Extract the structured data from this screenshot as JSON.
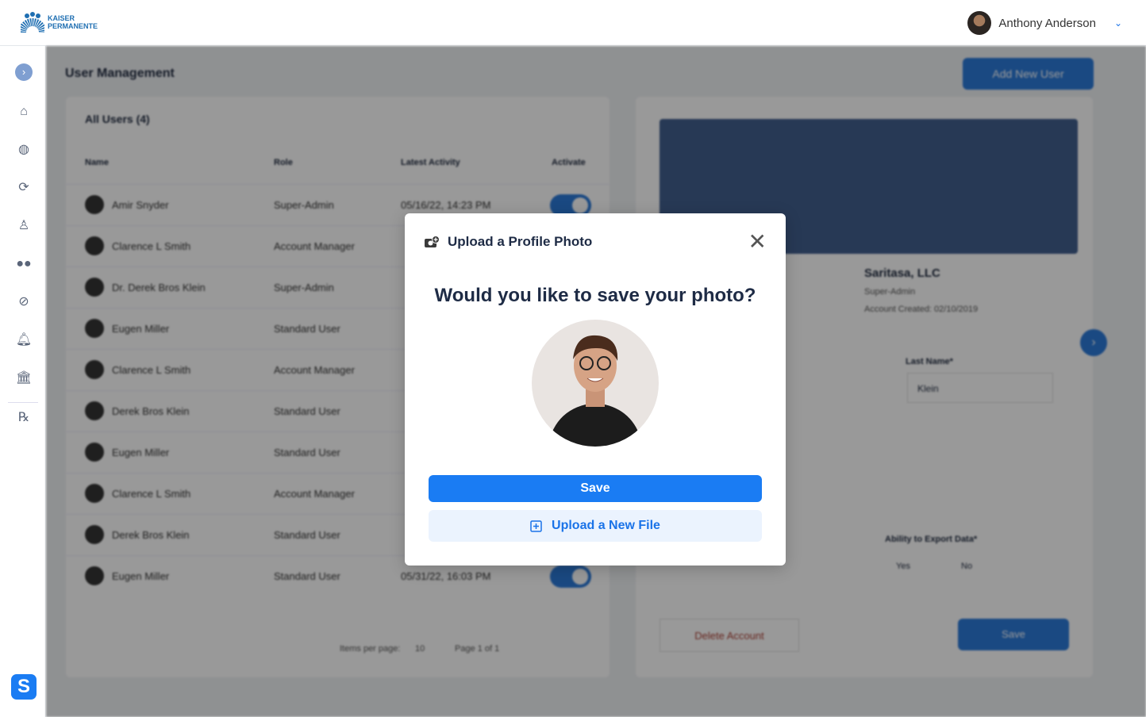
{
  "header": {
    "logo_line1": "KAISER",
    "logo_line2": "PERMANENTE",
    "user_name": "Anthony Anderson"
  },
  "sidebar": {
    "items": [
      "home-icon",
      "globe-icon",
      "sync-icon",
      "user-icon",
      "binoculars-icon",
      "pills-icon",
      "bell-icon",
      "bank-icon",
      "rx-icon"
    ]
  },
  "page": {
    "title": "User Management",
    "add_user": "Add New User"
  },
  "table": {
    "title": "All Users (4)",
    "columns": [
      "Name",
      "Role",
      "Latest Activity",
      "Activate"
    ],
    "rows": [
      {
        "name": "Amir Snyder",
        "role": "Super-Admin",
        "activity": "05/16/22, 14:23 PM"
      },
      {
        "name": "Clarence L Smith",
        "role": "Account Manager",
        "activity": ""
      },
      {
        "name": "Dr. Derek Bros Klein",
        "role": "Super-Admin",
        "activity": ""
      },
      {
        "name": "Eugen Miller",
        "role": "Standard User",
        "activity": ""
      },
      {
        "name": "Clarence L Smith",
        "role": "Account Manager",
        "activity": ""
      },
      {
        "name": "Derek Bros Klein",
        "role": "Standard User",
        "activity": ""
      },
      {
        "name": "Eugen Miller",
        "role": "Standard User",
        "activity": ""
      },
      {
        "name": "Clarence L Smith",
        "role": "Account Manager",
        "activity": ""
      },
      {
        "name": "Derek Bros Klein",
        "role": "Standard User",
        "activity": ""
      },
      {
        "name": "Eugen Miller",
        "role": "Standard User",
        "activity": "05/31/22, 16:03 PM"
      }
    ],
    "items_per_page_label": "Items per page:",
    "items_per_page": "10",
    "page_label": "Page 1 of 1"
  },
  "profile": {
    "company": "Saritasa, LLC",
    "role": "Super-Admin",
    "created": "Account Created: 02/10/2019",
    "last_name_label": "Last Name*",
    "last_name": "Klein",
    "export_label": "Ability to Export Data*",
    "yes": "Yes",
    "no": "No",
    "delete": "Delete Account",
    "save": "Save"
  },
  "modal": {
    "title": "Upload a Profile Photo",
    "question": "Would you like to save your photo?",
    "save": "Save",
    "upload_new": "Upload a New File"
  },
  "colors": {
    "primary": "#1a7cf3",
    "upload_bg": "#ebf3fe",
    "overlay": "#3c4b5f"
  }
}
